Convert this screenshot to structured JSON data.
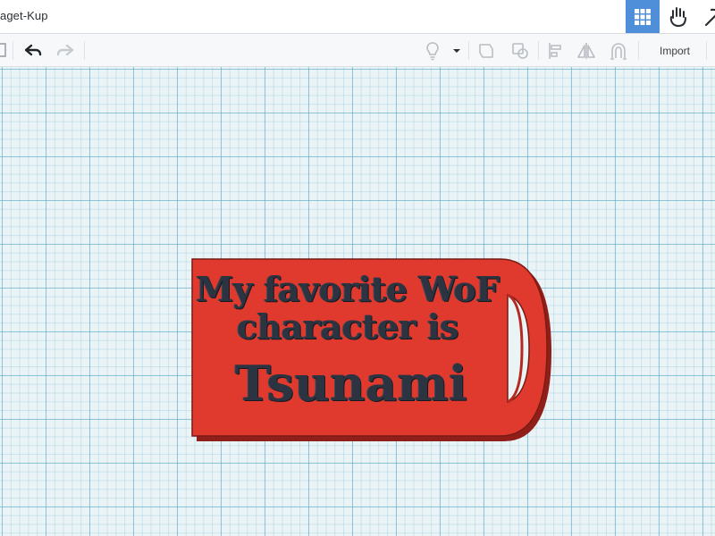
{
  "window": {
    "title": "aget-Kup"
  },
  "view_buttons": [
    {
      "name": "grid-view",
      "icon": "grid-icon",
      "active": true
    },
    {
      "name": "blocks-view",
      "icon": "hand-blocks-icon",
      "active": false
    },
    {
      "name": "bricks-view",
      "icon": "pickaxe-icon",
      "active": false
    }
  ],
  "toolbar": {
    "import_label": "Import",
    "tools": [
      "undo-icon",
      "redo-icon",
      "lightbulb-icon",
      "group-icon",
      "ungroup-icon",
      "align-icon",
      "mirror-icon",
      "magnet-icon"
    ]
  },
  "workplane": {
    "grid_color": "#5aaac8",
    "tag": {
      "color": "#e03a2e",
      "line1": "My favorite WoF",
      "line2": "character is",
      "line3": "Tsunami"
    }
  }
}
